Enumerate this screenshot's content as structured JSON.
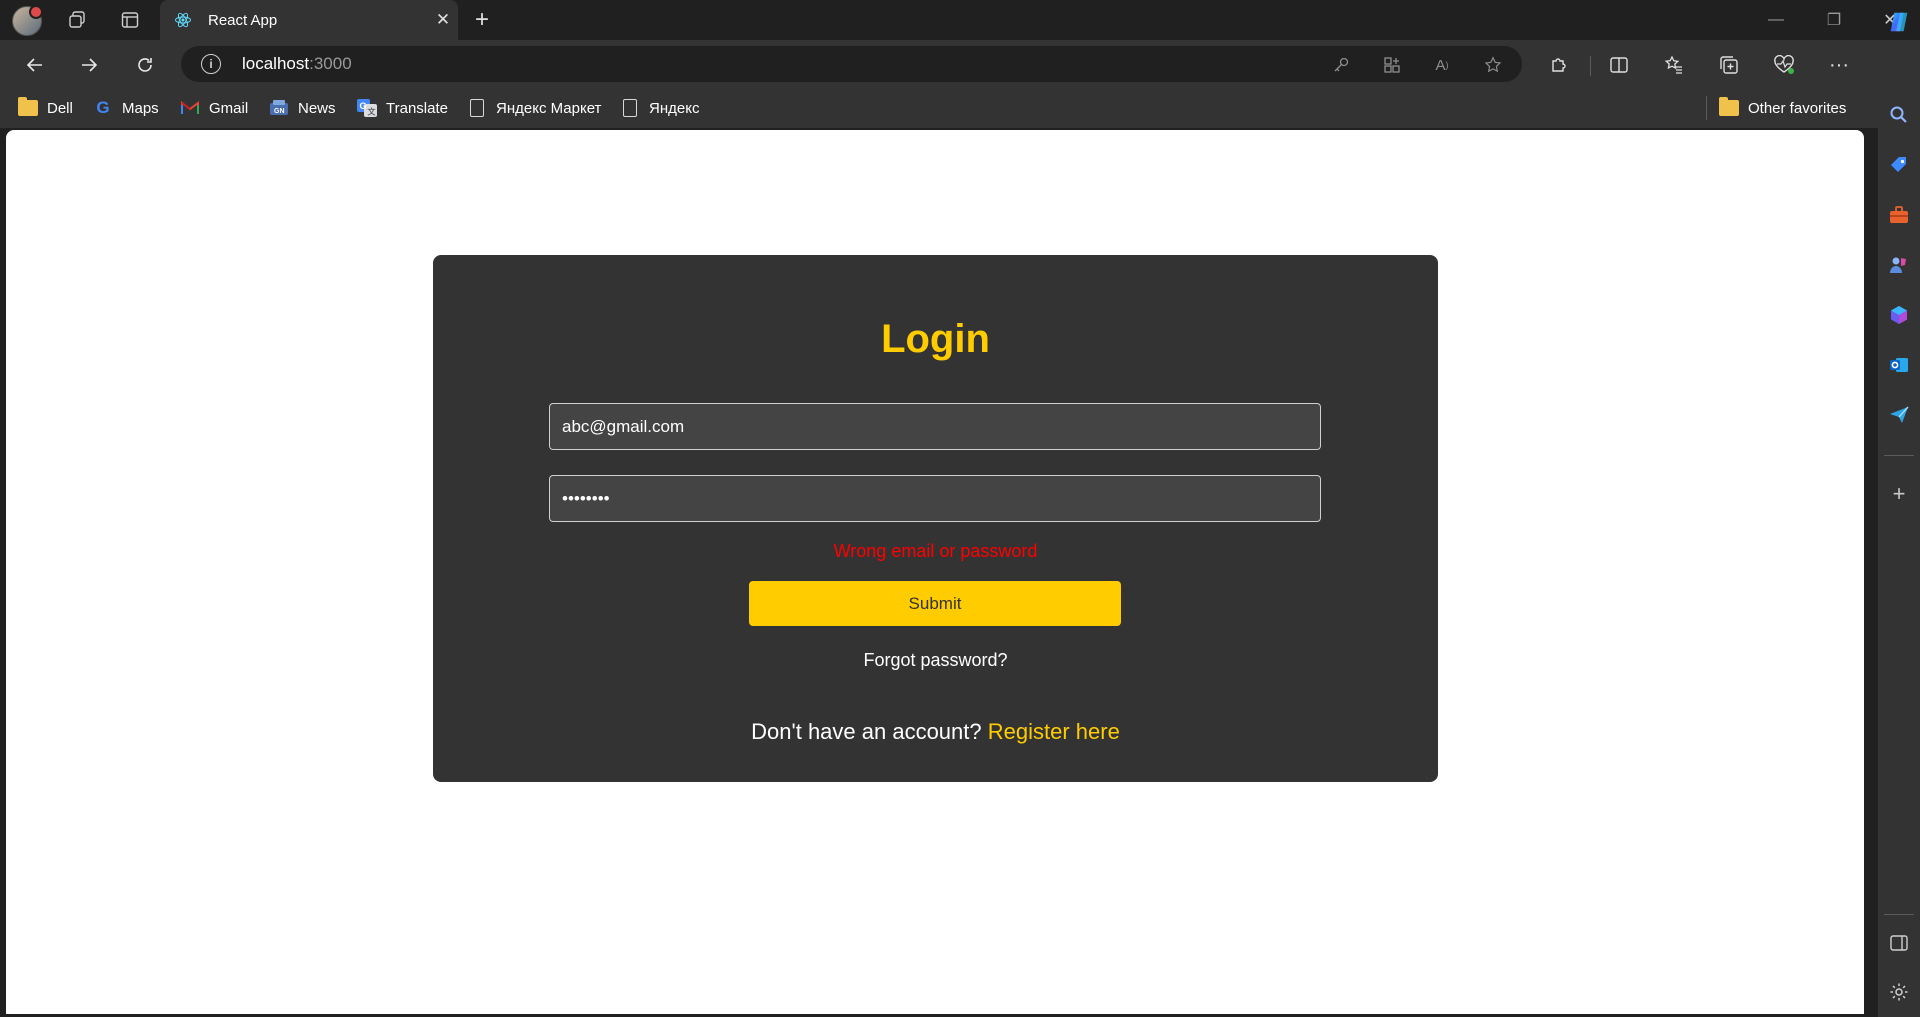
{
  "browser": {
    "tab": {
      "title": "React App",
      "close_glyph": "✕"
    },
    "new_tab_glyph": "+",
    "window_controls": [
      "—",
      "❐",
      "✕"
    ],
    "address": {
      "host": "localhost",
      "port": ":3000"
    },
    "bookmarks": [
      {
        "label": "Dell",
        "icon": "folder-icon"
      },
      {
        "label": "Maps",
        "icon": "google-icon"
      },
      {
        "label": "Gmail",
        "icon": "gmail-icon"
      },
      {
        "label": "News",
        "icon": "news-icon"
      },
      {
        "label": "Translate",
        "icon": "translate-icon"
      },
      {
        "label": "Яндекс Маркет",
        "icon": "page-icon"
      },
      {
        "label": "Яндекс",
        "icon": "page-icon"
      }
    ],
    "other_favorites": "Other favorites"
  },
  "login": {
    "title": "Login",
    "email_value": "abc@gmail.com",
    "password_value": "••••••••",
    "error": "Wrong email or password",
    "submit_label": "Submit",
    "forgot_label": "Forgot password?",
    "register_prompt": "Don't have an account? ",
    "register_link": "Register here"
  },
  "colors": {
    "accent": "#ffcc00",
    "error": "#ff0000",
    "card": "#333333",
    "browser_chrome": "#333333"
  }
}
